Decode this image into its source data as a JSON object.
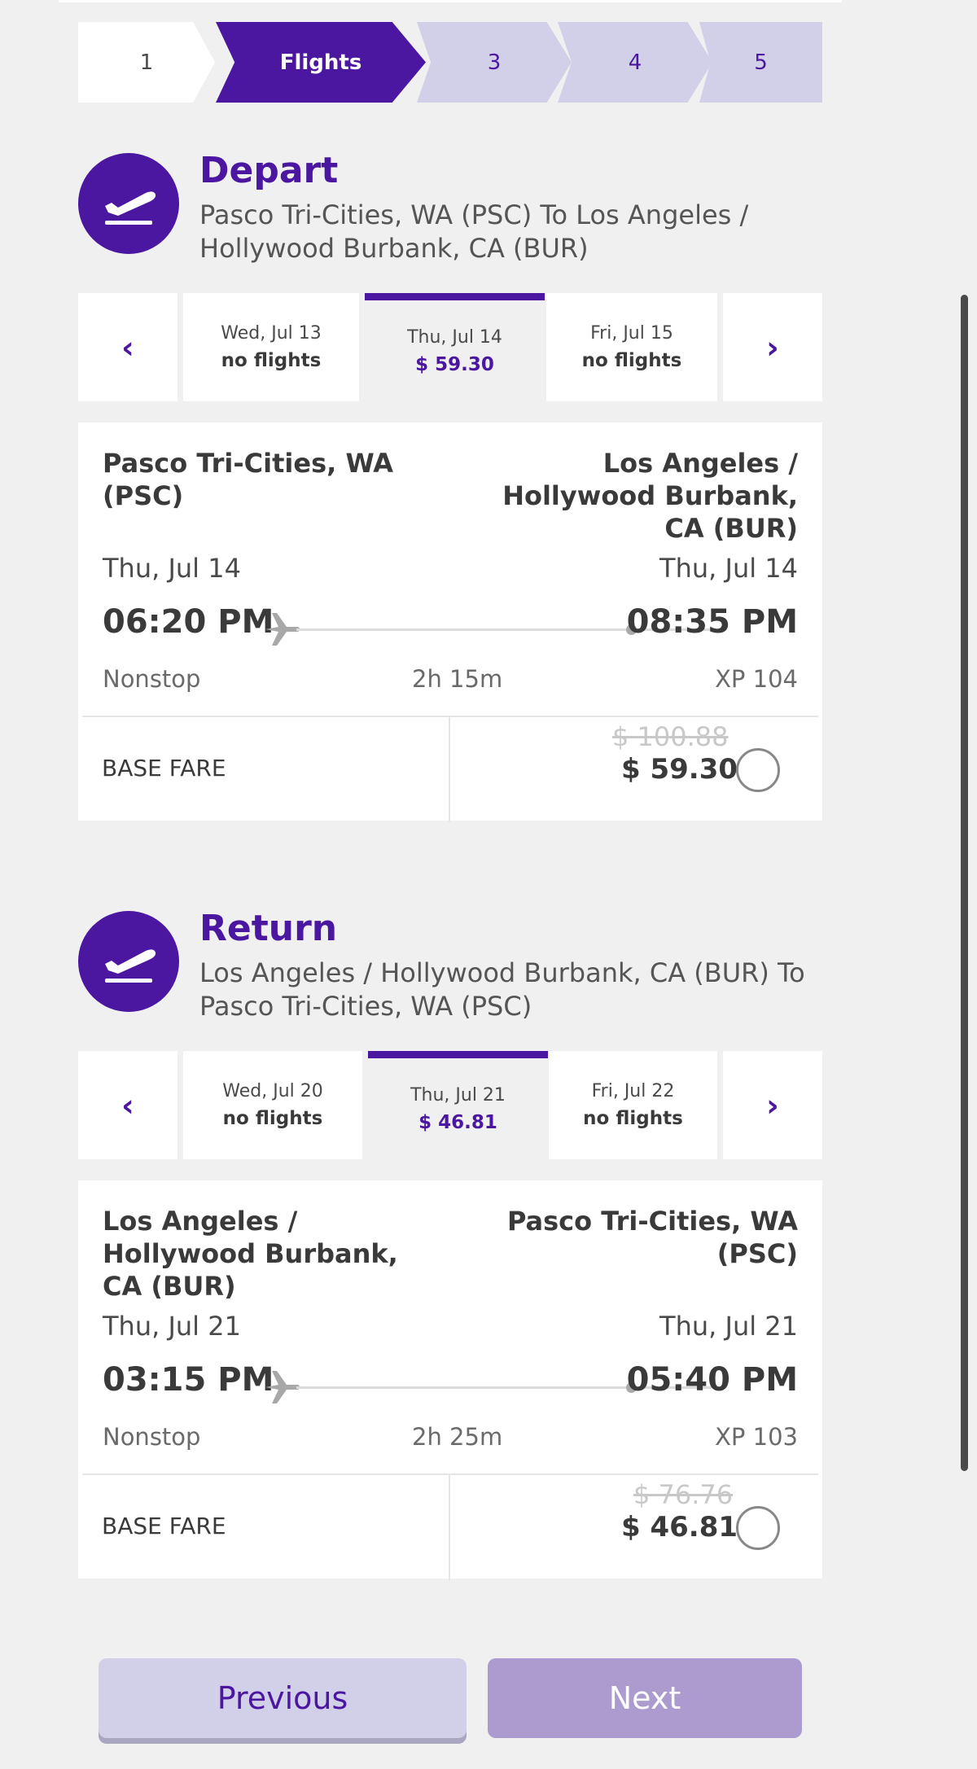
{
  "stepper": {
    "steps": [
      {
        "label": "1"
      },
      {
        "label": "Flights"
      },
      {
        "label": "3"
      },
      {
        "label": "4"
      },
      {
        "label": "5"
      }
    ]
  },
  "depart": {
    "title": "Depart",
    "route": "Pasco Tri-Cities, WA (PSC) To Los Angeles / Hollywood Burbank, CA (BUR)",
    "dates": [
      {
        "date": "Wed, Jul 13",
        "status": "no flights"
      },
      {
        "date": "Thu, Jul 14",
        "status": "$ 59.30"
      },
      {
        "date": "Fri, Jul 15",
        "status": "no flights"
      }
    ],
    "card": {
      "origin": "Pasco Tri-Cities, WA (PSC)",
      "destination": "Los Angeles / Hollywood Burbank, CA (BUR)",
      "depart_date": "Thu, Jul 14",
      "arrive_date": "Thu, Jul 14",
      "depart_time": "06:20 PM",
      "arrive_time": "08:35 PM",
      "stops": "Nonstop",
      "duration": "2h 15m",
      "flight_no": "XP 104",
      "fare_label": "BASE FARE",
      "old_price": "$ 100.88",
      "price": "$ 59.30"
    }
  },
  "return": {
    "title": "Return",
    "route": "Los Angeles / Hollywood Burbank, CA (BUR) To Pasco Tri-Cities, WA (PSC)",
    "dates": [
      {
        "date": "Wed, Jul 20",
        "status": "no flights"
      },
      {
        "date": "Thu, Jul 21",
        "status": "$ 46.81"
      },
      {
        "date": "Fri, Jul 22",
        "status": "no flights"
      }
    ],
    "card": {
      "origin": "Los Angeles / Hollywood Burbank, CA (BUR)",
      "destination": "Pasco Tri-Cities, WA (PSC)",
      "depart_date": "Thu, Jul 21",
      "arrive_date": "Thu, Jul 21",
      "depart_time": "03:15 PM",
      "arrive_time": "05:40 PM",
      "stops": "Nonstop",
      "duration": "2h 25m",
      "flight_no": "XP 103",
      "fare_label": "BASE FARE",
      "old_price": "$ 76.76",
      "price": "$ 46.81"
    }
  },
  "icons": {
    "prev": "chevron-left-icon",
    "next": "chevron-right-icon",
    "section": "plane-takeoff-icon",
    "route": "plane-icon"
  },
  "colors": {
    "brand": "#4b16a0",
    "step_inactive": "#d2cfe8",
    "next_button": "#ab9bcf"
  },
  "buttons": {
    "previous": "Previous",
    "next": "Next"
  }
}
